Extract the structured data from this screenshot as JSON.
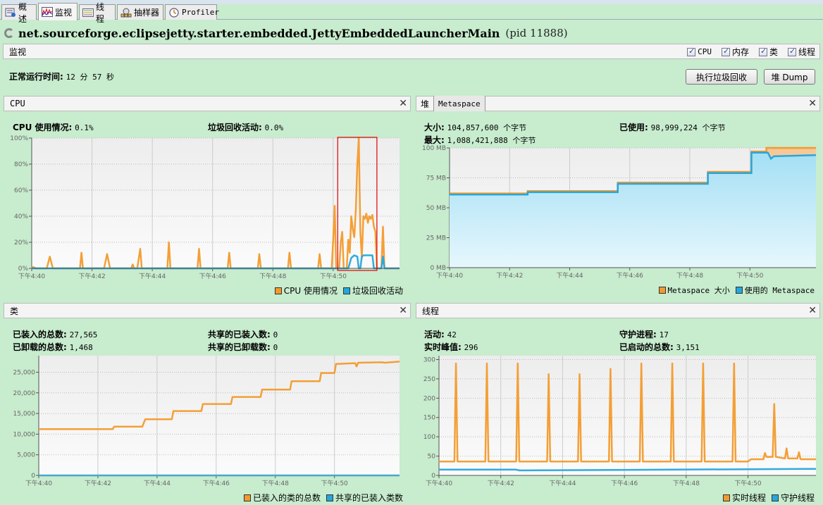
{
  "tabs": [
    {
      "label": "概述",
      "icon": "overview-icon"
    },
    {
      "label": "监视",
      "icon": "monitor-icon",
      "active": true
    },
    {
      "label": "线程",
      "icon": "threads-icon"
    },
    {
      "label": "抽样器",
      "icon": "sampler-icon"
    },
    {
      "label": "Profiler",
      "icon": "profiler-icon"
    }
  ],
  "title": {
    "main": "net.sourceforge.eclipsejetty.starter.embedded.JettyEmbeddedLauncherMain",
    "pid": "(pid 11888)"
  },
  "monitor": {
    "label": "监视",
    "checkboxes": [
      {
        "label": "CPU",
        "checked": true
      },
      {
        "label": "内存",
        "checked": true
      },
      {
        "label": "类",
        "checked": true
      },
      {
        "label": "线程",
        "checked": true
      }
    ],
    "uptime_label": "正常运行时间:",
    "uptime_value": "12 分 57 秒",
    "gc_button": "执行垃圾回收",
    "heap_dump_button": "堆 Dump"
  },
  "colors": {
    "orange": "#f39a2b",
    "blue": "#26a7dc",
    "highlight": "#e00000",
    "bg": "#c8ecce"
  },
  "x_ticks": [
    "下午4:40",
    "下午4:42",
    "下午4:44",
    "下午4:46",
    "下午4:48",
    "下午4:50"
  ],
  "cpu": {
    "title": "CPU",
    "usage_label": "CPU 使用情况:",
    "usage_value": "0.1%",
    "gc_label": "垃圾回收活动:",
    "gc_value": "0.0%",
    "legend": [
      "CPU 使用情况",
      "垃圾回收活动"
    ]
  },
  "memory": {
    "tabs": [
      "堆",
      "Metaspace"
    ],
    "size_label": "大小:",
    "size_value": "104,857,600 个字节",
    "used_label": "已使用:",
    "used_value": "98,999,224 个字节",
    "max_label": "最大:",
    "max_value": "1,088,421,888 个字节",
    "legend": [
      "Metaspace 大小",
      "使用的 Metaspace"
    ]
  },
  "classes": {
    "title": "类",
    "loaded_label": "已装入的总数:",
    "loaded_value": "27,565",
    "unloaded_label": "已卸载的总数:",
    "unloaded_value": "1,468",
    "shared_loaded_label": "共享的已装入数:",
    "shared_loaded_value": "0",
    "shared_unloaded_label": "共享的已卸载数:",
    "shared_unloaded_value": "0",
    "legend": [
      "已装入的类的总数",
      "共享的已装入类数"
    ]
  },
  "threads": {
    "title": "线程",
    "live_label": "活动:",
    "live_value": "42",
    "daemon_label": "守护进程:",
    "daemon_value": "17",
    "peak_label": "实时峰值:",
    "peak_value": "296",
    "started_label": "已启动的总数:",
    "started_value": "3,151",
    "legend": [
      "实时线程",
      "守护线程"
    ]
  },
  "chart_data": [
    {
      "type": "line",
      "title": "CPU",
      "ylim": [
        0,
        100
      ],
      "y_ticks": [
        "0%",
        "20%",
        "40%",
        "60%",
        "80%",
        "100%"
      ],
      "xlim": [
        0,
        12.2
      ],
      "series": [
        {
          "name": "CPU 使用情况",
          "points": [
            [
              0,
              0
            ],
            [
              0.05,
              1
            ],
            [
              0.15,
              0
            ],
            [
              0.5,
              0
            ],
            [
              0.6,
              9
            ],
            [
              0.7,
              0
            ],
            [
              1.6,
              0
            ],
            [
              1.65,
              12
            ],
            [
              1.7,
              0
            ],
            [
              2.4,
              0
            ],
            [
              2.5,
              11
            ],
            [
              2.6,
              0
            ],
            [
              3.3,
              0
            ],
            [
              3.35,
              3
            ],
            [
              3.4,
              0
            ],
            [
              3.5,
              0
            ],
            [
              3.6,
              15
            ],
            [
              3.65,
              0
            ],
            [
              4.5,
              0
            ],
            [
              4.55,
              20
            ],
            [
              4.6,
              0
            ],
            [
              5.5,
              0
            ],
            [
              5.55,
              15
            ],
            [
              5.6,
              0
            ],
            [
              6.5,
              0
            ],
            [
              6.55,
              12
            ],
            [
              6.6,
              0
            ],
            [
              7.5,
              0
            ],
            [
              7.55,
              11
            ],
            [
              7.6,
              0
            ],
            [
              8.5,
              0
            ],
            [
              8.55,
              12
            ],
            [
              8.6,
              0
            ],
            [
              9.5,
              0
            ],
            [
              9.55,
              11
            ],
            [
              9.6,
              0
            ],
            [
              9.95,
              0
            ],
            [
              10.0,
              22
            ],
            [
              10.05,
              48
            ],
            [
              10.1,
              0
            ],
            [
              10.2,
              0
            ],
            [
              10.25,
              20
            ],
            [
              10.3,
              28
            ],
            [
              10.35,
              0
            ],
            [
              10.45,
              0
            ],
            [
              10.5,
              22
            ],
            [
              10.55,
              12
            ],
            [
              10.6,
              40
            ],
            [
              10.65,
              30
            ],
            [
              10.7,
              24
            ],
            [
              10.75,
              45
            ],
            [
              10.8,
              80
            ],
            [
              10.85,
              100
            ],
            [
              10.9,
              28
            ],
            [
              10.95,
              8
            ],
            [
              11.0,
              40
            ],
            [
              11.05,
              38
            ],
            [
              11.1,
              42
            ],
            [
              11.15,
              35
            ],
            [
              11.2,
              40
            ],
            [
              11.25,
              38
            ],
            [
              11.3,
              41
            ],
            [
              11.35,
              32
            ],
            [
              11.4,
              28
            ],
            [
              11.45,
              0
            ],
            [
              11.6,
              0
            ],
            [
              11.65,
              32
            ],
            [
              11.7,
              0
            ],
            [
              12.2,
              0
            ]
          ]
        },
        {
          "name": "垃圾回收活动",
          "points": [
            [
              0,
              0
            ],
            [
              10.5,
              0
            ],
            [
              10.6,
              8
            ],
            [
              10.7,
              10
            ],
            [
              10.8,
              9
            ],
            [
              10.85,
              0
            ],
            [
              10.9,
              0
            ],
            [
              10.95,
              9
            ],
            [
              11.0,
              10
            ],
            [
              11.3,
              10
            ],
            [
              11.35,
              0
            ],
            [
              11.6,
              0
            ],
            [
              11.65,
              9
            ],
            [
              11.7,
              0
            ],
            [
              12.2,
              0
            ]
          ]
        }
      ],
      "annotation": {
        "type": "highlight-box",
        "x_range": [
          10.15,
          11.45
        ],
        "y_range": [
          0,
          100
        ]
      }
    },
    {
      "type": "area",
      "title": "Metaspace",
      "ylim": [
        0,
        100
      ],
      "y_ticks": [
        "0 MB",
        "25 MB",
        "50 MB",
        "75 MB",
        "100 MB"
      ],
      "xlim": [
        0,
        12.2
      ],
      "series": [
        {
          "name": "Metaspace 大小",
          "points": [
            [
              0,
              62
            ],
            [
              2.6,
              62
            ],
            [
              2.6,
              64
            ],
            [
              5.6,
              64
            ],
            [
              5.6,
              71
            ],
            [
              8.6,
              71
            ],
            [
              8.6,
              80
            ],
            [
              10.05,
              80
            ],
            [
              10.05,
              97
            ],
            [
              10.55,
              97
            ],
            [
              10.55,
              100
            ],
            [
              12.2,
              100
            ]
          ]
        },
        {
          "name": "使用的 Metaspace",
          "points": [
            [
              0,
              61
            ],
            [
              2.6,
              61
            ],
            [
              2.6,
              63
            ],
            [
              5.6,
              63
            ],
            [
              5.6,
              70
            ],
            [
              8.6,
              70
            ],
            [
              8.6,
              79
            ],
            [
              10.05,
              79
            ],
            [
              10.05,
              96
            ],
            [
              10.55,
              96
            ],
            [
              10.6,
              96
            ],
            [
              10.7,
              91
            ],
            [
              10.8,
              93
            ],
            [
              12.2,
              94
            ]
          ]
        }
      ]
    },
    {
      "type": "line",
      "title": "类",
      "ylim": [
        0,
        29000
      ],
      "y_ticks": [
        "0",
        "5,000",
        "10,000",
        "15,000",
        "20,000",
        "25,000"
      ],
      "xlim": [
        0,
        12.2
      ],
      "series": [
        {
          "name": "已装入的类的总数",
          "points": [
            [
              0,
              11200
            ],
            [
              2.5,
              11200
            ],
            [
              2.55,
              11800
            ],
            [
              3.5,
              11800
            ],
            [
              3.6,
              13600
            ],
            [
              4.5,
              13600
            ],
            [
              4.55,
              15600
            ],
            [
              5.5,
              15600
            ],
            [
              5.55,
              17300
            ],
            [
              6.5,
              17300
            ],
            [
              6.55,
              19000
            ],
            [
              7.5,
              19000
            ],
            [
              7.55,
              20800
            ],
            [
              8.5,
              20800
            ],
            [
              8.55,
              22800
            ],
            [
              9.5,
              22800
            ],
            [
              9.55,
              24800
            ],
            [
              10.0,
              24800
            ],
            [
              10.05,
              27000
            ],
            [
              10.7,
              27200
            ],
            [
              10.75,
              26400
            ],
            [
              10.8,
              27300
            ],
            [
              11.6,
              27400
            ],
            [
              11.7,
              27300
            ],
            [
              12.2,
              27565
            ]
          ]
        },
        {
          "name": "共享的已装入类数",
          "points": [
            [
              0,
              0
            ],
            [
              12.2,
              0
            ]
          ]
        }
      ]
    },
    {
      "type": "line",
      "title": "线程",
      "ylim": [
        0,
        310
      ],
      "y_ticks": [
        "0",
        "50",
        "100",
        "150",
        "200",
        "250",
        "300"
      ],
      "xlim": [
        0,
        12.2
      ],
      "series": [
        {
          "name": "实时线程",
          "points": [
            [
              0,
              36
            ],
            [
              0.5,
              36
            ],
            [
              0.55,
              290
            ],
            [
              0.6,
              36
            ],
            [
              1.5,
              36
            ],
            [
              1.55,
              290
            ],
            [
              1.6,
              36
            ],
            [
              2.5,
              36
            ],
            [
              2.55,
              290
            ],
            [
              2.6,
              36
            ],
            [
              3.5,
              36
            ],
            [
              3.55,
              262
            ],
            [
              3.6,
              36
            ],
            [
              4.5,
              36
            ],
            [
              4.55,
              262
            ],
            [
              4.6,
              36
            ],
            [
              5.5,
              36
            ],
            [
              5.55,
              276
            ],
            [
              5.6,
              36
            ],
            [
              6.5,
              36
            ],
            [
              6.55,
              290
            ],
            [
              6.6,
              36
            ],
            [
              7.5,
              36
            ],
            [
              7.55,
              290
            ],
            [
              7.6,
              36
            ],
            [
              8.5,
              36
            ],
            [
              8.55,
              290
            ],
            [
              8.6,
              36
            ],
            [
              9.5,
              36
            ],
            [
              9.55,
              290
            ],
            [
              9.6,
              36
            ],
            [
              10.0,
              36
            ],
            [
              10.1,
              42
            ],
            [
              10.5,
              42
            ],
            [
              10.55,
              58
            ],
            [
              10.6,
              48
            ],
            [
              10.8,
              48
            ],
            [
              10.85,
              185
            ],
            [
              10.9,
              48
            ],
            [
              11.2,
              44
            ],
            [
              11.25,
              70
            ],
            [
              11.3,
              44
            ],
            [
              11.6,
              44
            ],
            [
              11.65,
              60
            ],
            [
              11.7,
              42
            ],
            [
              12.2,
              42
            ]
          ]
        },
        {
          "name": "守护线程",
          "points": [
            [
              0,
              15
            ],
            [
              2.5,
              15
            ],
            [
              2.6,
              13
            ],
            [
              12.2,
              17
            ]
          ]
        }
      ]
    }
  ]
}
